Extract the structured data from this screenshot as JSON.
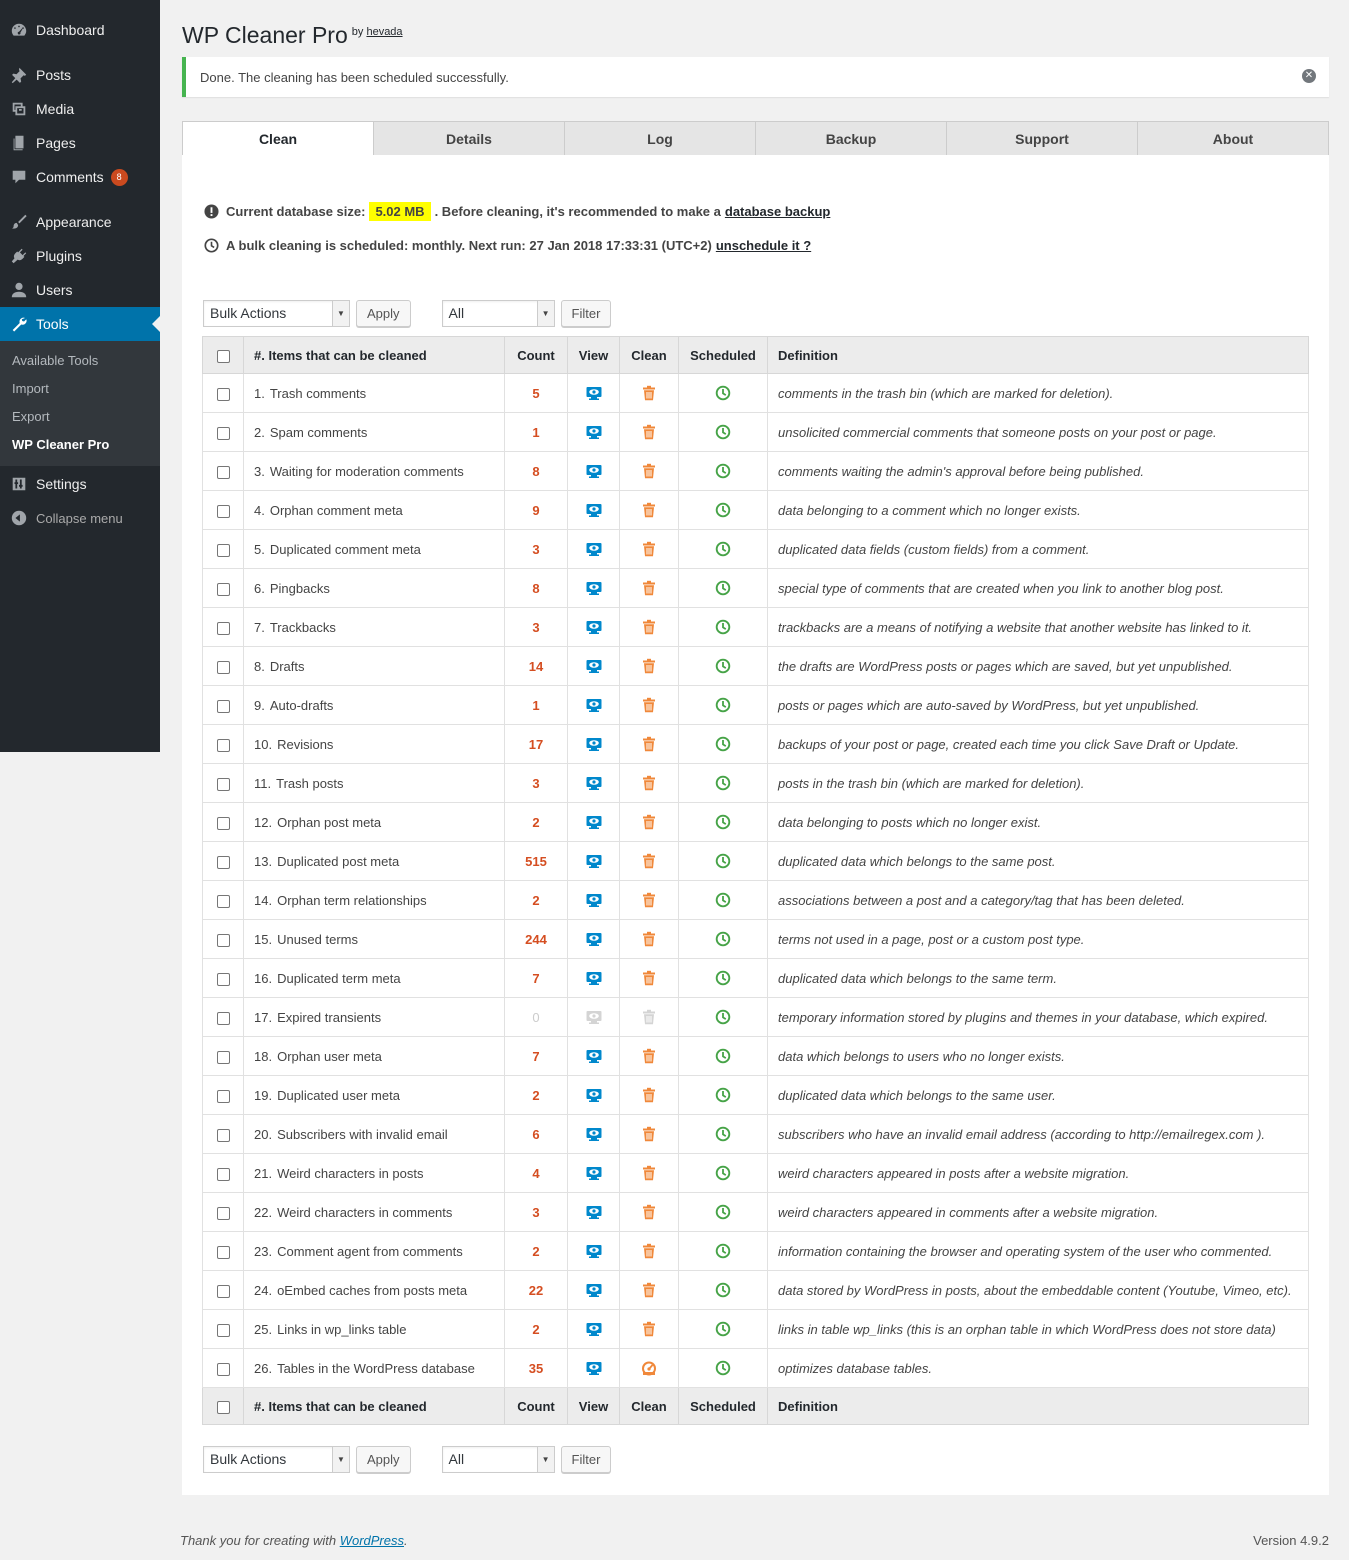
{
  "sidebar": {
    "items": [
      {
        "label": "Dashboard",
        "icon": "dashboard-icon"
      },
      {
        "label": "Posts",
        "icon": "pin-icon"
      },
      {
        "label": "Media",
        "icon": "media-icon"
      },
      {
        "label": "Pages",
        "icon": "pages-icon"
      },
      {
        "label": "Comments",
        "icon": "comment-icon",
        "badge": "8"
      },
      {
        "label": "Appearance",
        "icon": "brush-icon"
      },
      {
        "label": "Plugins",
        "icon": "plug-icon"
      },
      {
        "label": "Users",
        "icon": "user-icon"
      },
      {
        "label": "Tools",
        "icon": "wrench-icon"
      },
      {
        "label": "Settings",
        "icon": "settings-icon"
      },
      {
        "label": "Collapse menu",
        "icon": "collapse-icon"
      }
    ],
    "submenu": [
      "Available Tools",
      "Import",
      "Export",
      "WP Cleaner Pro"
    ]
  },
  "header": {
    "title": "WP Cleaner Pro",
    "by": "by",
    "author": "hevada"
  },
  "notice": {
    "text": "Done. The cleaning has been scheduled successfully."
  },
  "tabs": [
    "Clean",
    "Details",
    "Log",
    "Backup",
    "Support",
    "About"
  ],
  "info": {
    "db_label": "Current database size:",
    "db_size": "5.02 MB",
    "db_after": ". Before cleaning, it's recommended to make a",
    "db_link": "database backup",
    "schedule_text": "A bulk cleaning is scheduled: monthly. Next run: 27 Jan 2018 17:33:31 (UTC+2)",
    "schedule_link": "unschedule it ?"
  },
  "actions": {
    "bulk": "Bulk Actions",
    "apply": "Apply",
    "filter_value": "All",
    "filter": "Filter"
  },
  "table": {
    "headers": {
      "item": "#. Items that can be cleaned",
      "count": "Count",
      "view": "View",
      "clean": "Clean",
      "scheduled": "Scheduled",
      "definition": "Definition"
    },
    "rows": [
      {
        "n": "1.",
        "name": "Trash comments",
        "count": "5",
        "def": "comments in the trash bin (which are marked for deletion)."
      },
      {
        "n": "2.",
        "name": "Spam comments",
        "count": "1",
        "def": "unsolicited commercial comments that someone posts on your post or page."
      },
      {
        "n": "3.",
        "name": "Waiting for moderation comments",
        "count": "8",
        "def": "comments waiting the admin's approval before being published."
      },
      {
        "n": "4.",
        "name": "Orphan comment meta",
        "count": "9",
        "def": "data belonging to a comment which no longer exists."
      },
      {
        "n": "5.",
        "name": "Duplicated comment meta",
        "count": "3",
        "def": "duplicated data fields (custom fields) from a comment."
      },
      {
        "n": "6.",
        "name": "Pingbacks",
        "count": "8",
        "def": "special type of comments that are created when you link to another blog post."
      },
      {
        "n": "7.",
        "name": "Trackbacks",
        "count": "3",
        "def": "trackbacks are a means of notifying a website that another website has linked to it."
      },
      {
        "n": "8.",
        "name": "Drafts",
        "count": "14",
        "def": "the drafts are WordPress posts or pages which are saved, but yet unpublished."
      },
      {
        "n": "9.",
        "name": "Auto-drafts",
        "count": "1",
        "def": "posts or pages which are auto-saved by WordPress, but yet unpublished."
      },
      {
        "n": "10.",
        "name": "Revisions",
        "count": "17",
        "def": "backups of your post or page, created each time you click Save Draft or Update."
      },
      {
        "n": "11.",
        "name": "Trash posts",
        "count": "3",
        "def": "posts in the trash bin (which are marked for deletion)."
      },
      {
        "n": "12.",
        "name": "Orphan post meta",
        "count": "2",
        "def": "data belonging to posts which no longer exist."
      },
      {
        "n": "13.",
        "name": "Duplicated post meta",
        "count": "515",
        "def": "duplicated data which belongs to the same post."
      },
      {
        "n": "14.",
        "name": "Orphan term relationships",
        "count": "2",
        "def": "associations between a post and a category/tag that has been deleted."
      },
      {
        "n": "15.",
        "name": "Unused terms",
        "count": "244",
        "def": "terms not used in a page, post or a custom post type."
      },
      {
        "n": "16.",
        "name": "Duplicated term meta",
        "count": "7",
        "def": "duplicated data which belongs to the same term."
      },
      {
        "n": "17.",
        "name": "Expired transients",
        "count": "0",
        "def": "temporary information stored by plugins and themes in your database, which expired.",
        "disabled": true
      },
      {
        "n": "18.",
        "name": "Orphan user meta",
        "count": "7",
        "def": "data which belongs to users who no longer exists."
      },
      {
        "n": "19.",
        "name": "Duplicated user meta",
        "count": "2",
        "def": "duplicated data which belongs to the same user."
      },
      {
        "n": "20.",
        "name": "Subscribers with invalid email",
        "count": "6",
        "def": "subscribers who have an invalid email address (according to http://emailregex.com )."
      },
      {
        "n": "21.",
        "name": "Weird characters in posts",
        "count": "4",
        "def": "weird characters appeared in posts after a website migration."
      },
      {
        "n": "22.",
        "name": "Weird characters in comments",
        "count": "3",
        "def": "weird characters appeared in comments after a website migration."
      },
      {
        "n": "23.",
        "name": "Comment agent from comments",
        "count": "2",
        "def": "information containing the browser and operating system of the user who commented."
      },
      {
        "n": "24.",
        "name": "oEmbed caches from posts meta",
        "count": "22",
        "def": "data stored by WordPress in posts, about the embeddable content (Youtube, Vimeo, etc)."
      },
      {
        "n": "25.",
        "name": "Links in wp_links table",
        "count": "2",
        "def": "links in table wp_links (this is an orphan table in which WordPress does not store data)"
      },
      {
        "n": "26.",
        "name": "Tables in the WordPress database",
        "count": "35",
        "def": "optimizes database tables.",
        "optimize": true
      }
    ]
  },
  "footer": {
    "thanks_pre": "Thank you for creating with",
    "thanks_link": "WordPress",
    "thanks_post": ".",
    "version": "Version 4.9.2"
  },
  "colors": {
    "accent": "#0073aa",
    "count": "#d54e21",
    "view": "#0088cc",
    "clean": "#f0883a",
    "scheduled": "#46a347",
    "notice": "#46b450"
  }
}
